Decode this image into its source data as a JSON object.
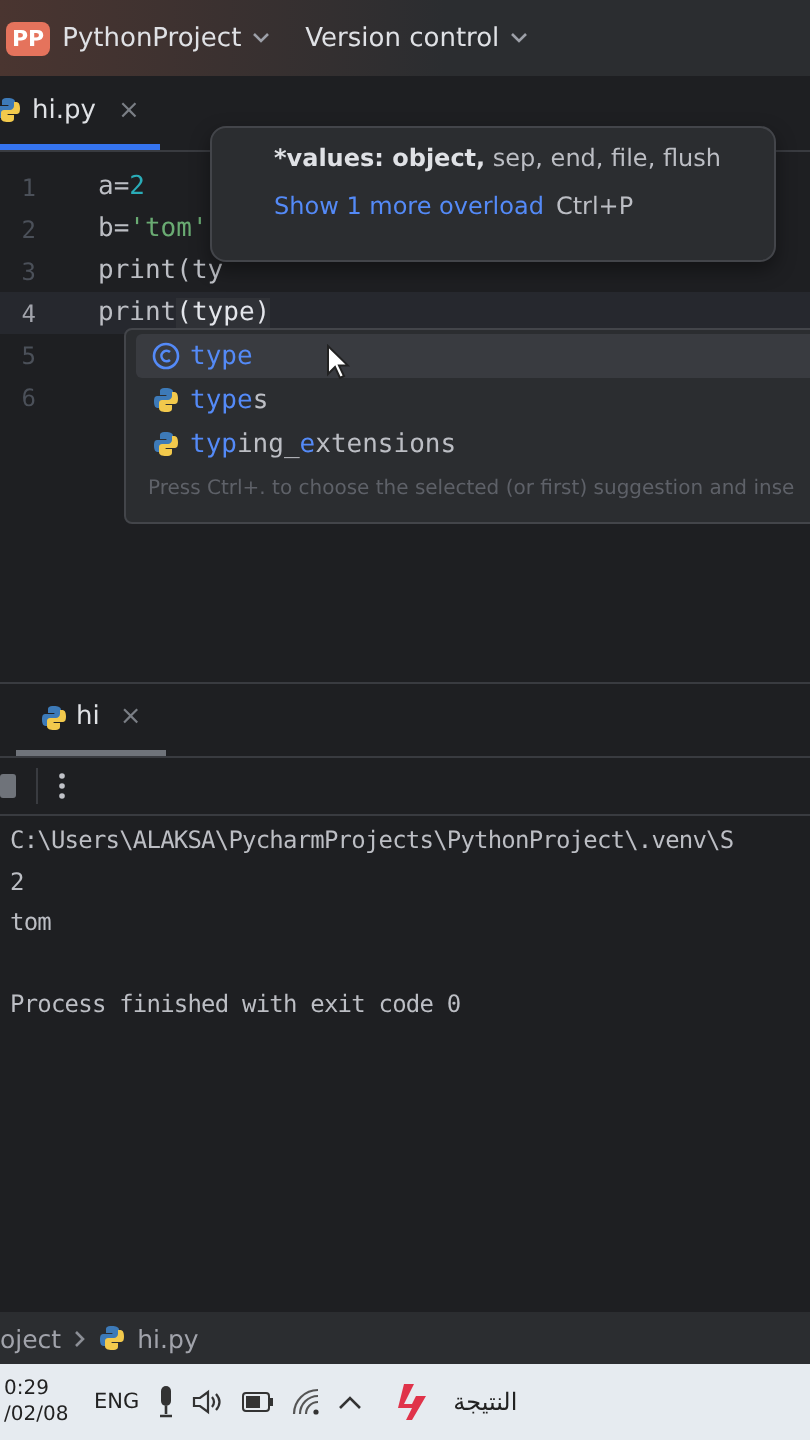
{
  "title_bar": {
    "project_badge": "PP",
    "project": "PythonProject",
    "vcs": "Version control"
  },
  "editor_tabs": [
    {
      "label": "hi.py",
      "close": "×",
      "selected": true
    }
  ],
  "code_lines": [
    {
      "number": "1",
      "current": false,
      "tokens": [
        {
          "text": "a=",
          "kind": "plain"
        },
        {
          "text": "2",
          "kind": "number"
        }
      ]
    },
    {
      "number": "2",
      "current": false,
      "tokens": [
        {
          "text": "b=",
          "kind": "plain"
        },
        {
          "text": "'tom'",
          "kind": "string"
        }
      ]
    },
    {
      "number": "3",
      "current": false,
      "tokens": [
        {
          "text": "print(ty",
          "kind": "plain"
        }
      ]
    },
    {
      "number": "4",
      "current": true,
      "tokens": [
        {
          "text": "print",
          "kind": "plain"
        },
        {
          "text": "(type)",
          "kind": "paren"
        }
      ]
    },
    {
      "number": "5",
      "current": false
    },
    {
      "number": "6",
      "current": false
    }
  ],
  "parameter_info": {
    "signature_bold": "*values: object,",
    "signature_rest": " sep, end, file, flush",
    "link": "Show 1 more overload",
    "shortcut": "Ctrl+P"
  },
  "completion": {
    "items": [
      {
        "kind": "class",
        "selected": true,
        "segments": [
          {
            "text": "type",
            "match": true
          }
        ]
      },
      {
        "kind": "module",
        "selected": false,
        "segments": [
          {
            "text": "type",
            "match": true
          },
          {
            "text": "s",
            "match": false
          }
        ]
      },
      {
        "kind": "module",
        "selected": false,
        "segments": [
          {
            "text": "typ",
            "match": true
          },
          {
            "text": "ing_",
            "match": false
          },
          {
            "text": "e",
            "match": true
          },
          {
            "text": "xtensions",
            "match": false
          }
        ]
      }
    ],
    "hint": "Press Ctrl+. to choose the selected (or first) suggestion and inse"
  },
  "run_tabs": [
    {
      "label": "hi",
      "close": "×",
      "selected": true
    }
  ],
  "console": {
    "lines": [
      "C:\\Users\\ALAKSA\\PycharmProjects\\PythonProject\\.venv\\S",
      "2",
      "tom"
    ],
    "exit_message": "Process finished with exit code 0"
  },
  "breadcrumb": [
    "oject",
    "hi.py"
  ],
  "taskbar": {
    "time": "0:29",
    "date": "/02/08",
    "language": "ENG",
    "app_label": "النتيجة"
  }
}
